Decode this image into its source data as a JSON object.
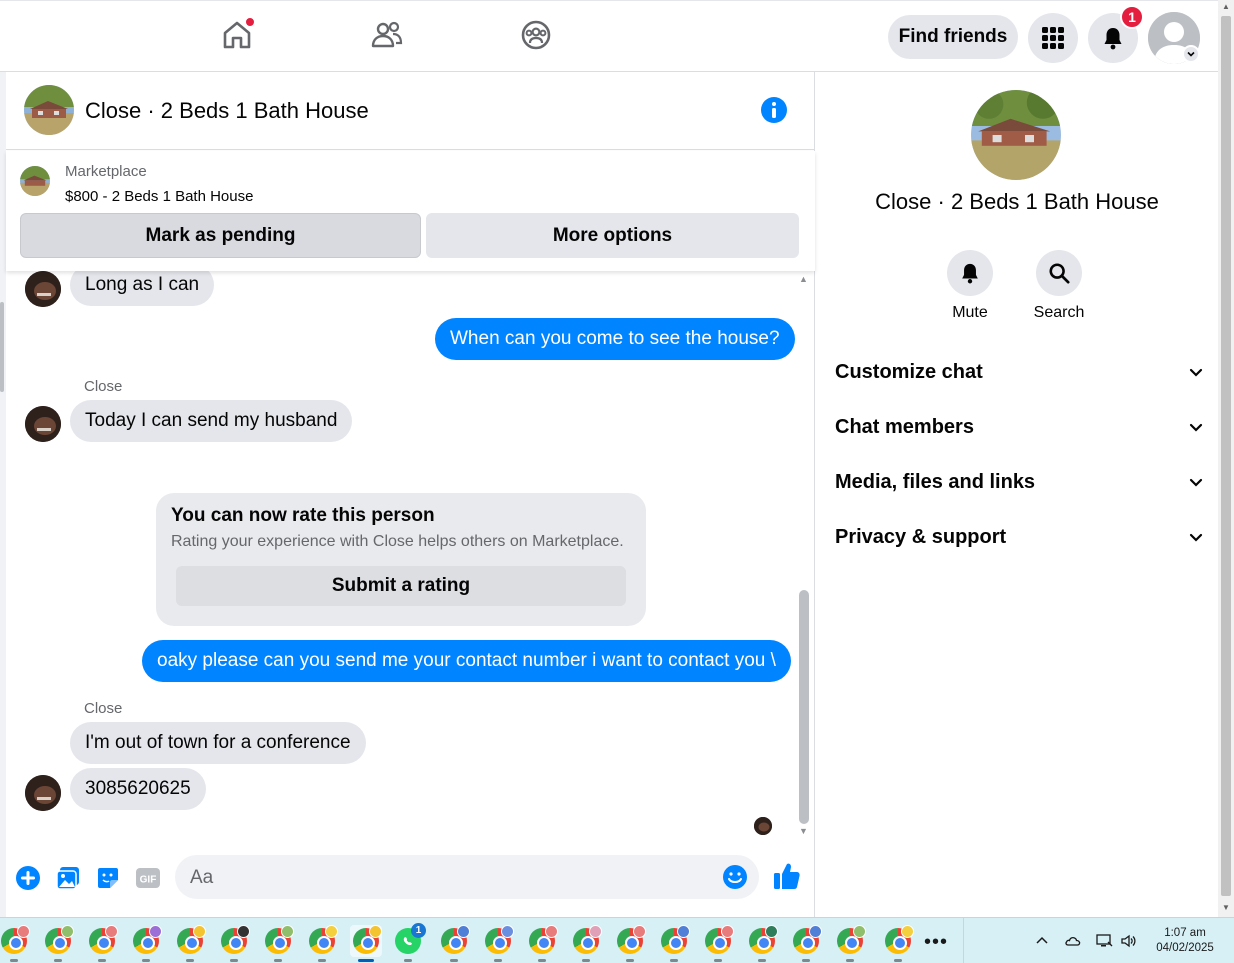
{
  "topbar": {
    "find_friends_label": "Find friends",
    "notification_count": "1"
  },
  "chat": {
    "title": "Close · 2 Beds 1 Bath House",
    "marketplace": {
      "label": "Marketplace",
      "listing": "$800 - 2 Beds 1 Bath House",
      "mark_pending_label": "Mark as pending",
      "more_options_label": "More options"
    },
    "messages": [
      {
        "direction": "in",
        "text": "Long as I can"
      },
      {
        "direction": "out",
        "text": "When can you come to see the house?"
      },
      {
        "direction": "in",
        "sender": "Close",
        "text": "Today I can send my husband"
      },
      {
        "direction": "out",
        "text": "oaky please can you send me your contact number i want to contact you \\"
      },
      {
        "direction": "in",
        "sender": "Close",
        "text": "I'm out of town for a conference"
      },
      {
        "direction": "in",
        "text": "3085620625"
      }
    ],
    "rating_card": {
      "title": "You can now rate this person",
      "description": "Rating your experience with Close helps others on Marketplace.",
      "button_label": "Submit a rating"
    },
    "composer": {
      "placeholder": "Aa"
    }
  },
  "details": {
    "title": "Close · 2 Beds 1 Bath House",
    "actions": [
      {
        "label": "Mute",
        "icon": "bell-icon"
      },
      {
        "label": "Search",
        "icon": "search-icon"
      }
    ],
    "sections": [
      {
        "label": "Customize chat"
      },
      {
        "label": "Chat members"
      },
      {
        "label": "Media, files and links"
      },
      {
        "label": "Privacy & support"
      }
    ]
  },
  "taskbar": {
    "whatsapp_badge": "1",
    "time": "1:07 am",
    "date": "04/02/2025"
  },
  "colors": {
    "messenger_blue": "#0084ff",
    "incoming_bubble": "#e4e6eb",
    "badge_red": "#e41e3f"
  }
}
